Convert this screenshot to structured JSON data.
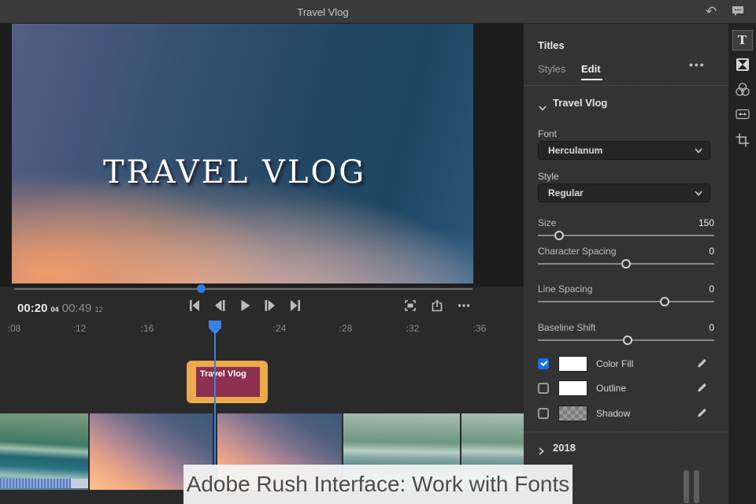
{
  "topbar": {
    "title": "Travel Vlog"
  },
  "preview": {
    "overlay_text": "TRAVEL VLOG"
  },
  "transport": {
    "current_time": "00:20",
    "current_frames": "04",
    "duration": "00:49",
    "duration_frames": "12"
  },
  "ruler": {
    "ticks": [
      ":08",
      ":12",
      ":16",
      ":24",
      ":28",
      ":32",
      ":36"
    ]
  },
  "timeline": {
    "title_clip_label": "Travel Vlog"
  },
  "panel": {
    "title": "Titles",
    "tabs": [
      {
        "label": "Styles",
        "active": false
      },
      {
        "label": "Edit",
        "active": true
      }
    ],
    "more_label": "•••",
    "section_title": "Travel Vlog",
    "font": {
      "label": "Font",
      "value": "Herculanum"
    },
    "style": {
      "label": "Style",
      "value": "Regular"
    },
    "sliders": [
      {
        "label": "Size",
        "value": "150",
        "pos": 12
      },
      {
        "label": "Character Spacing",
        "value": "0",
        "pos": 50
      },
      {
        "label": "Line Spacing",
        "value": "0",
        "pos": 72
      },
      {
        "label": "Baseline Shift",
        "value": "0",
        "pos": 51
      }
    ],
    "color_rows": [
      {
        "label": "Color Fill",
        "checked": true,
        "swatch": "white"
      },
      {
        "label": "Outline",
        "checked": false,
        "swatch": "white"
      },
      {
        "label": "Shadow",
        "checked": false,
        "swatch": "checker"
      }
    ],
    "collapsed_section": "2018",
    "accent_color": "#1473e6"
  },
  "caption": {
    "text": "Adobe Rush Interface: Work with Fonts"
  }
}
